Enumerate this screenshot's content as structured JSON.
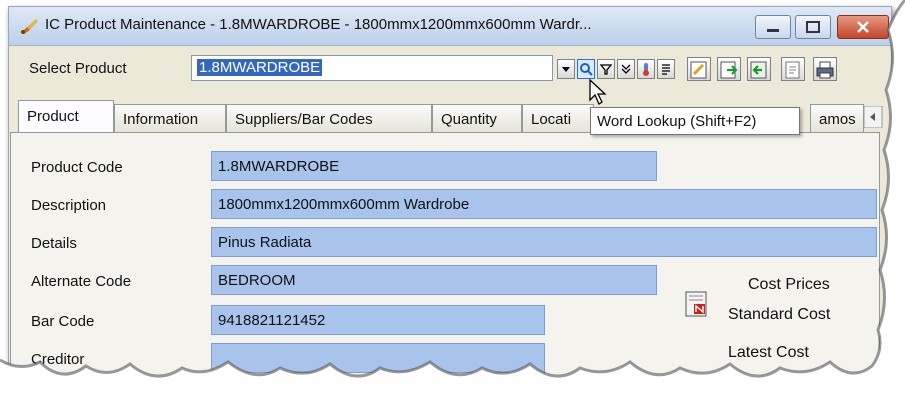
{
  "window": {
    "title": "IC Product Maintenance - 1.8MWARDROBE - 1800mmx1200mmx600mm Wardr...",
    "app_icon": "brush-icon",
    "controls": {
      "minimize_icon": "minimize-icon",
      "maximize_icon": "maximize-icon",
      "close_icon": "close-icon"
    }
  },
  "select_product": {
    "label": "Select Product",
    "value": "1.8MWARDROBE"
  },
  "toolbar_icons": [
    "dropdown-arrow-icon",
    "word-lookup-icon",
    "filter-icon",
    "expand-icon",
    "thermometer-icon",
    "list-icon",
    "edit-note-icon",
    "export-icon",
    "import-icon",
    "document-icon",
    "print-icon"
  ],
  "tabs": [
    {
      "label": "Product",
      "active": true
    },
    {
      "label": "Information"
    },
    {
      "label": "Suppliers/Bar Codes"
    },
    {
      "label": "Quantity"
    },
    {
      "label": "Locati"
    },
    {
      "label": "amos"
    }
  ],
  "tooltip": "Word Lookup (Shift+F2)",
  "fields": {
    "product_code": {
      "label": "Product Code",
      "value": "1.8MWARDROBE"
    },
    "description": {
      "label": "Description",
      "value": "1800mmx1200mmx600mm Wardrobe"
    },
    "details": {
      "label": "Details",
      "value": "Pinus Radiata"
    },
    "alternate_code": {
      "label": "Alternate Code",
      "value": "BEDROOM"
    },
    "bar_code": {
      "label": "Bar Code",
      "value": "9418821121452"
    },
    "creditor": {
      "label": "Creditor",
      "value": ""
    }
  },
  "cost_prices": {
    "title": "Cost Prices",
    "standard_cost_label": "Standard Cost",
    "latest_cost_label": "Latest Cost"
  }
}
